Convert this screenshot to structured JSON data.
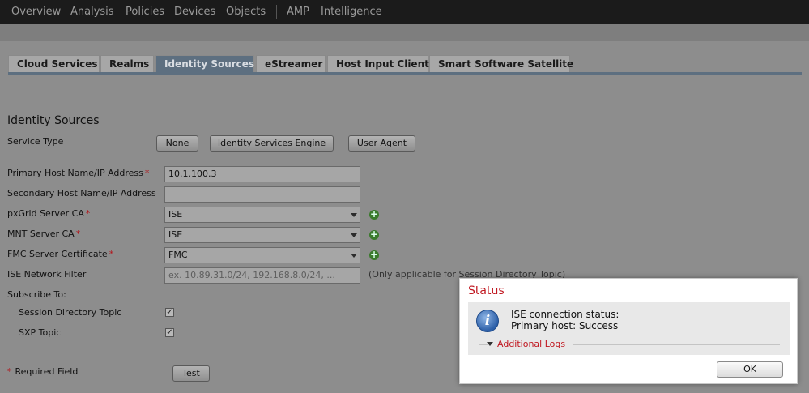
{
  "topnav": {
    "items": [
      "Overview",
      "Analysis",
      "Policies",
      "Devices",
      "Objects",
      "AMP",
      "Intelligence"
    ]
  },
  "tabs": [
    "Cloud Services",
    "Realms",
    "Identity Sources",
    "eStreamer",
    "Host Input Client",
    "Smart Software Satellite"
  ],
  "active_tab": "Identity Sources",
  "section": {
    "title": "Identity Sources"
  },
  "service_type": {
    "label": "Service Type",
    "options": [
      "None",
      "Identity Services Engine",
      "User Agent"
    ],
    "selected": "Identity Services Engine"
  },
  "form": {
    "primary_host": {
      "label": "Primary Host Name/IP Address",
      "value": "10.1.100.3",
      "required": "*"
    },
    "secondary_host": {
      "label": "Secondary Host Name/IP Address",
      "value": ""
    },
    "pxgrid_ca": {
      "label": "pxGrid Server CA",
      "value": "ISE",
      "required": "*"
    },
    "mnt_ca": {
      "label": "MNT Server CA",
      "value": "ISE",
      "required": "*"
    },
    "fmc_cert": {
      "label": "FMC Server Certificate",
      "value": "FMC",
      "required": "*"
    },
    "network_filter": {
      "label": "ISE Network Filter",
      "placeholder": "ex. 10.89.31.0/24, 192.168.8.0/24, ...",
      "hint": "(Only applicable for Session Directory Topic)"
    },
    "subscribe_label": "Subscribe To:",
    "session_directory": {
      "label": "Session Directory Topic",
      "checked": true,
      "mark": "✓"
    },
    "sxp_topic": {
      "label": "SXP Topic",
      "checked": true,
      "mark": "✓"
    },
    "required_note": {
      "star": "*",
      "text": "Required Field"
    },
    "test_label": "Test",
    "add_glyph": "+"
  },
  "dialog": {
    "title": "Status",
    "icon": "info-icon",
    "icon_glyph": "i",
    "line1": "ISE connection status:",
    "line2": "Primary host: Success",
    "logs_link": "Additional Logs",
    "ok_label": "OK"
  },
  "colors": {
    "topnav_bg": "#1b1b1b",
    "active_tab": "#5d6f80",
    "required": "#b3141a",
    "dialog_title": "#c0161f"
  }
}
